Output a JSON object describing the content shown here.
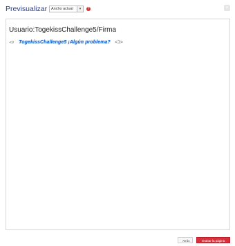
{
  "dialog": {
    "title": "Previsualizar",
    "width_select": {
      "value": "Ancho actual",
      "arrow": "▾"
    },
    "help_icon": "?",
    "close_icon": "×"
  },
  "preview": {
    "page_title": "Usuario:TogekissChallenge5/Firma",
    "signature": {
      "left_mark": "≺∂",
      "text": "TogekissChallenge5 ¡Algún problema?",
      "right_mark": "<Ↄ>"
    }
  },
  "footer": {
    "back_label": "Atrás",
    "save_label": "Grabar la página"
  },
  "colors": {
    "title": "#2a3f8f",
    "save_button": "#d9303b",
    "signature": "#1a64c8"
  }
}
